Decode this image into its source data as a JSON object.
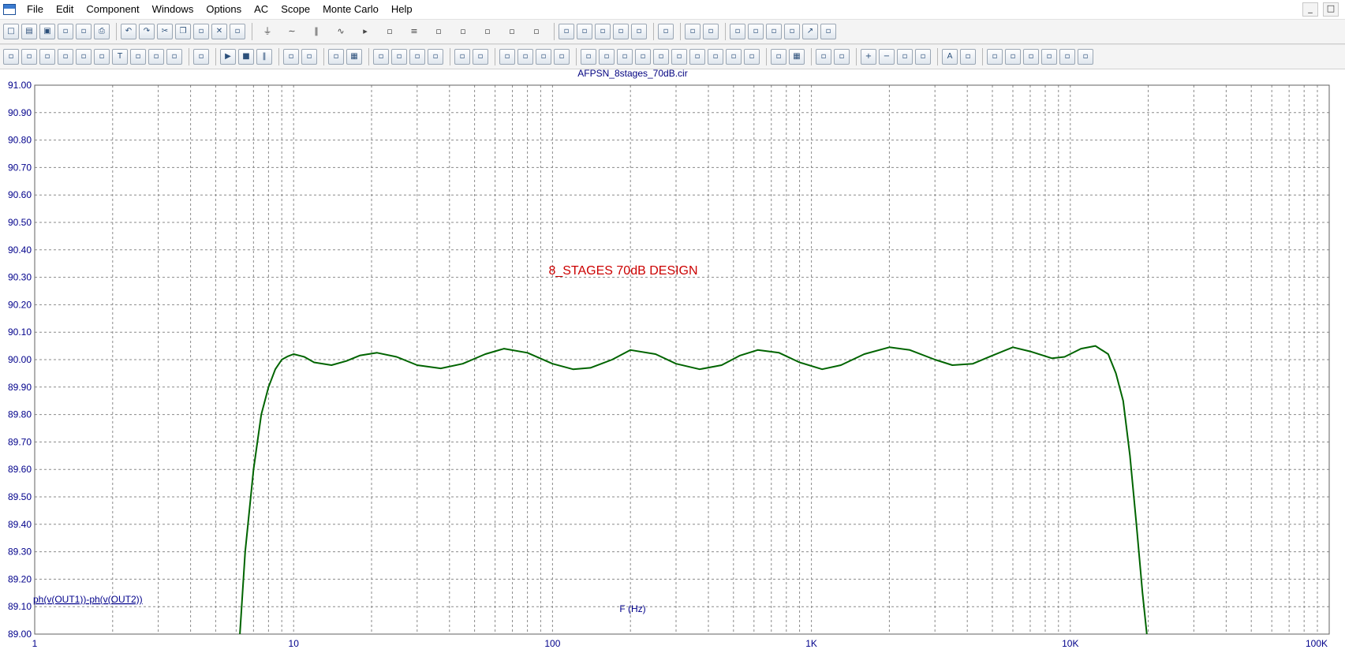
{
  "menubar": {
    "items": [
      "File",
      "Edit",
      "Component",
      "Windows",
      "Options",
      "AC",
      "Scope",
      "Monte Carlo",
      "Help"
    ],
    "window_controls": [
      "_",
      "□"
    ]
  },
  "toolbar1": {
    "icons": [
      "new-icon",
      "open-icon",
      "save-icon",
      "save-as-icon",
      "print-preview-icon",
      "print-icon",
      "undo-icon",
      "redo-icon",
      "cut-icon",
      "copy-icon",
      "paste-icon",
      "delete-icon",
      "select-all-icon",
      "ground-icon",
      "inductor-icon",
      "capacitor-icon",
      "resistor-icon",
      "diode-icon",
      "transistor-icon",
      "battery-icon",
      "opamp-icon",
      "macro-icon",
      "switch-icon",
      "source-icon",
      "meter-icon",
      "window-icon",
      "tile-icon",
      "cascade-icon",
      "properties-icon",
      "calculator-icon",
      "analysis-icon",
      "help-icon",
      "globe-icon",
      "probe-icon",
      "grid-icon",
      "plot-icon",
      "tools-icon",
      "chart-icon",
      "chart-edit-icon"
    ]
  },
  "toolbar2": {
    "icons": [
      "select-icon",
      "pan-icon",
      "magic-icon",
      "image-icon",
      "component-icon",
      "wire-icon",
      "text-icon",
      "formula-icon",
      "graph-icon",
      "bold-text-icon",
      "clipboard-icon",
      "run-icon",
      "stop-icon",
      "pause-icon",
      "cursor-left-icon",
      "cursor-right-icon",
      "box-icon",
      "grid-toggle-icon",
      "plot-1-icon",
      "plot-2-icon",
      "plot-3-icon",
      "plot-4-icon",
      "hline-icon",
      "cross-icon",
      "zoom-icon",
      "zoom-fit-icon",
      "zoom-area-icon",
      "zoom-out-icon",
      "peak-icon",
      "valley-icon",
      "high-icon",
      "low-icon",
      "slope-icon",
      "inflection-icon",
      "next-icon",
      "prev-icon",
      "cycle-icon",
      "waveform-icon",
      "paste-plot-icon",
      "table-icon",
      "tag-icon",
      "scale-icon",
      "zoom-in-icon",
      "zoom-minus-icon",
      "zoom-reset-icon",
      "tiles-icon",
      "font-icon",
      "style-icon",
      "align-left-icon",
      "align-center-icon",
      "align-right-icon",
      "align-top-icon",
      "align-middle-icon",
      "align-bottom-icon"
    ]
  },
  "colors": {
    "curve": "#006400",
    "axis_text": "#00008b",
    "title": "#000080",
    "annotation": "#cc0000",
    "grid": "#8a8a8a"
  },
  "chart_data": {
    "type": "line",
    "title": "AFPSN_8stages_70dB.cir",
    "annotation": "8_STAGES 70dB DESIGN",
    "xlabel": "F (Hz)",
    "ylabel": "",
    "x_scale": "log",
    "xlim": [
      1,
      100000
    ],
    "ylim": [
      89.0,
      91.0
    ],
    "x_ticks": [
      1,
      10,
      100,
      1000,
      10000,
      100000
    ],
    "x_tick_labels": [
      "1",
      "10",
      "100",
      "1K",
      "10K",
      "100K"
    ],
    "y_ticks": [
      89.0,
      89.1,
      89.2,
      89.3,
      89.4,
      89.5,
      89.6,
      89.7,
      89.8,
      89.9,
      90.0,
      90.1,
      90.2,
      90.3,
      90.4,
      90.5,
      90.6,
      90.7,
      90.8,
      90.9,
      91.0
    ],
    "y_tick_labels": [
      "89.00",
      "89.10",
      "89.20",
      "89.30",
      "89.40",
      "89.50",
      "89.60",
      "89.70",
      "89.80",
      "89.90",
      "90.00",
      "90.10",
      "90.20",
      "90.30",
      "90.40",
      "90.50",
      "90.60",
      "90.70",
      "90.80",
      "90.90",
      "91.00"
    ],
    "grid": true,
    "series": [
      {
        "name": "ph(v(OUT1))-ph(v(OUT2))",
        "x": [
          6.2,
          6.5,
          7.0,
          7.5,
          8.0,
          8.5,
          9.0,
          9.5,
          10,
          11,
          12,
          14,
          16,
          18,
          21,
          25,
          30,
          37,
          45,
          55,
          65,
          80,
          100,
          120,
          140,
          170,
          200,
          250,
          300,
          370,
          450,
          530,
          620,
          750,
          900,
          1100,
          1300,
          1600,
          2000,
          2400,
          3000,
          3500,
          4200,
          5000,
          6000,
          7000,
          8500,
          9500,
          11000,
          12500,
          14000,
          15000,
          16000,
          17000,
          18000,
          19000,
          20000
        ],
        "y": [
          89.0,
          89.3,
          89.6,
          89.8,
          89.9,
          89.965,
          90.0,
          90.012,
          90.02,
          90.01,
          89.99,
          89.98,
          89.995,
          90.015,
          90.025,
          90.01,
          89.98,
          89.968,
          89.985,
          90.02,
          90.04,
          90.025,
          89.985,
          89.965,
          89.97,
          90.0,
          90.035,
          90.02,
          89.985,
          89.965,
          89.98,
          90.015,
          90.035,
          90.025,
          89.99,
          89.965,
          89.98,
          90.02,
          90.045,
          90.035,
          90.0,
          89.98,
          89.985,
          90.015,
          90.045,
          90.03,
          90.005,
          90.01,
          90.04,
          90.05,
          90.02,
          89.95,
          89.85,
          89.65,
          89.4,
          89.15,
          88.95
        ]
      }
    ]
  }
}
